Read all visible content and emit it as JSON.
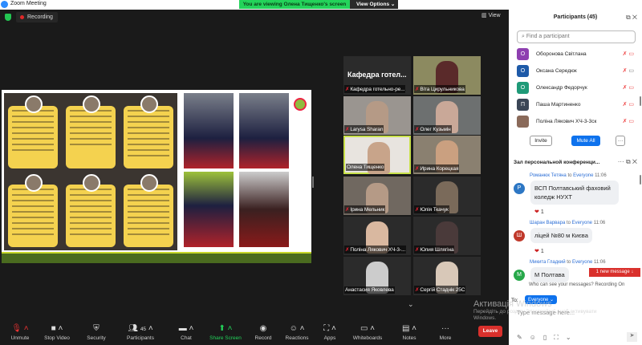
{
  "window": {
    "title": "Zoom Meeting"
  },
  "banner": {
    "viewing": "You are viewing Олена Тищенко's screen",
    "view_options": "View Options"
  },
  "status": {
    "recording": "Recording",
    "view": "View"
  },
  "gallery": [
    {
      "name": "Кафедра готельно-ре...",
      "big": "Кафедра готел..."
    },
    {
      "name": "Віта Цирульникова"
    },
    {
      "name": "Larysa Sharan"
    },
    {
      "name": "Олег Кузьмін"
    },
    {
      "name": "Олена Тищенко"
    },
    {
      "name": "Ирина Корецкая"
    },
    {
      "name": "Ірина Мельник"
    },
    {
      "name": "Юлія Ткачук"
    },
    {
      "name": "Поліна Лякович ХЧ-3-..."
    },
    {
      "name": "Юлия Шлягіна"
    },
    {
      "name": "Анастасия Яковлева"
    },
    {
      "name": "Сергій Стаднік 25С"
    }
  ],
  "toolbar": {
    "unmute": "Unmute",
    "stop_video": "Stop Video",
    "security": "Security",
    "participants": "Participants",
    "participants_count": "45",
    "chat": "Chat",
    "share_screen": "Share Screen",
    "record": "Record",
    "reactions": "Reactions",
    "apps": "Apps",
    "whiteboards": "Whiteboards",
    "notes": "Notes",
    "more": "More",
    "leave": "Leave"
  },
  "participants": {
    "title": "Participants (45)",
    "search_placeholder": "Find a participant",
    "list": [
      {
        "initial": "О",
        "name": "Оборонова Світлана",
        "color": "#8e3fb0"
      },
      {
        "initial": "О",
        "name": "Оксана Середюк",
        "color": "#1e5aa8"
      },
      {
        "initial": "О",
        "name": "Олександр Федорчук",
        "color": "#1f9a78"
      },
      {
        "initial": "П",
        "name": "Паша Мартиненко",
        "color": "#3b4656"
      },
      {
        "initial": "",
        "name": "Поліна Лякович ХЧ-3-3ск",
        "color": "#8a6a5a"
      }
    ],
    "invite": "Invite",
    "mute_all": "Mute All",
    "more": "···"
  },
  "chat": {
    "title": "Зал персональной конференци...",
    "messages": [
      {
        "sender": "Романюк Тетяна",
        "to": "to",
        "recipient": "Everyone",
        "time": "11:06",
        "initial": "Р",
        "color": "#2d77c4",
        "text": "ВСП Полтавський фаховий коледж НУХТ",
        "reaction": "1"
      },
      {
        "sender": "Шаран Варвара",
        "to": "to",
        "recipient": "Everyone",
        "time": "11:06",
        "initial": "Ш",
        "color": "#c0392b",
        "text": "ліцей №80 м Києва",
        "reaction": "1"
      },
      {
        "sender": "Микита Гладкий",
        "to": "to",
        "recipient": "Everyone",
        "time": "11:06",
        "initial": "М",
        "color": "#27a84a",
        "text": "М Полтава"
      }
    ],
    "new_message": "1 new message ↓",
    "who_can_see": "Who can see your messages? Recording On",
    "to_label": "To:",
    "recipient": "Everyone ⌄",
    "placeholder": "Type message here..."
  },
  "watermark": {
    "title": "Активація Windows",
    "line1": "Перейдіть до розділу \"Настройки\", щоб активувати",
    "line2": "Windows."
  }
}
